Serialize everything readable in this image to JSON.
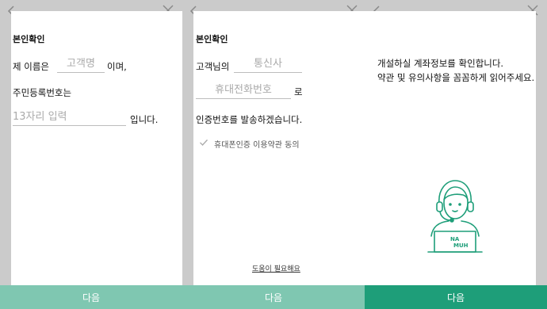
{
  "panel1": {
    "title": "본인확인",
    "line1_prefix": "제 이름은",
    "name_placeholder": "고객명",
    "line1_suffix": "이며,",
    "line2": "주민등록번호는",
    "rrn_placeholder": "13자리 입력",
    "line3_suffix": "입니다.",
    "next_label": "다음"
  },
  "panel2": {
    "title": "본인확인",
    "carrier_prefix": "고객님의",
    "carrier_placeholder": "통신사",
    "phone_placeholder": "휴대전화번호",
    "phone_suffix": "로",
    "send_text": "인증번호를 발송하겠습니다.",
    "consent_label": "휴대폰인증 이용약관 동의",
    "help_label": "도움이 필요해요",
    "next_label": "다음"
  },
  "panel3": {
    "info_line1": "개설하실 계좌정보를 확인합니다.",
    "info_line2": "약관 및 유의사항을 꼼꼼하게 읽어주세요.",
    "laptop_logo_top": "NA",
    "laptop_logo_bottom": "MUH",
    "next_label": "다음"
  },
  "colors": {
    "accent": "#1e9e79",
    "accent_light": "#7fc7b1",
    "background": "#cbcbcb"
  },
  "icons": {
    "back": "chevron-left-icon",
    "close": "close-icon",
    "check": "checkmark-icon",
    "agent": "headset-agent-illustration"
  }
}
